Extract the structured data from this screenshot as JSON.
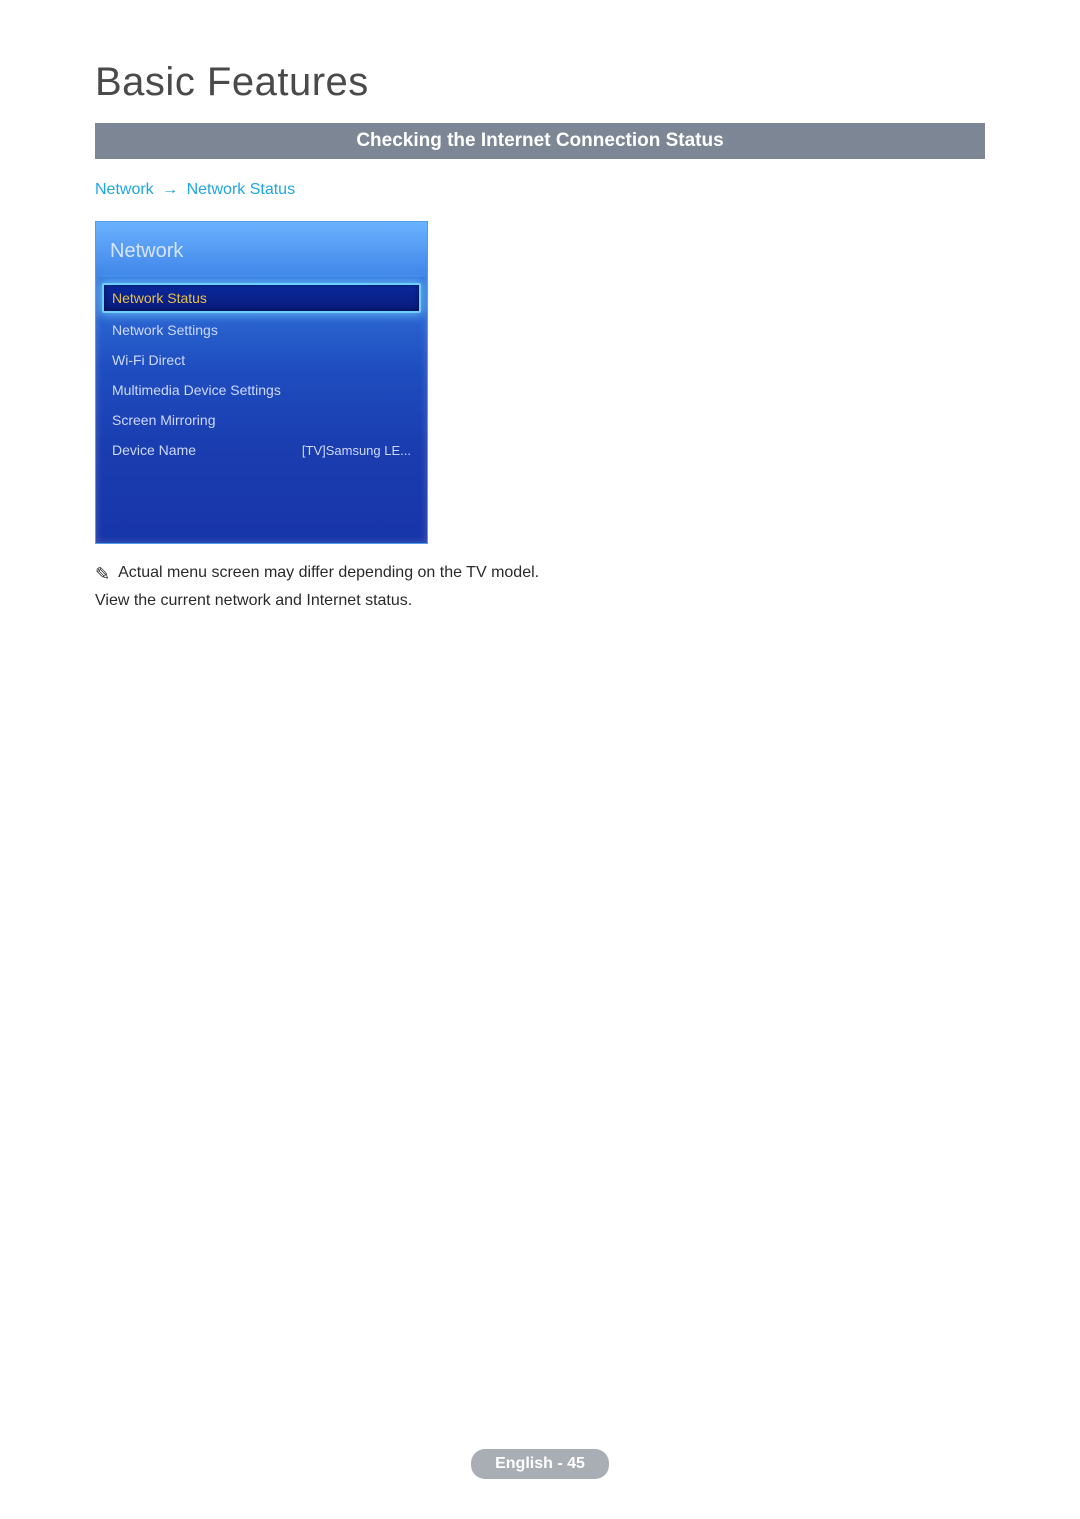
{
  "page_title": "Basic Features",
  "section_bar": "Checking the Internet Connection Status",
  "breadcrumb": {
    "seg1": "Network",
    "arrow": "→",
    "seg2": "Network Status"
  },
  "menu": {
    "header": "Network",
    "items": [
      {
        "label": "Network Status",
        "value": "",
        "selected": true
      },
      {
        "label": "Network Settings",
        "value": "",
        "selected": false
      },
      {
        "label": "Wi-Fi Direct",
        "value": "",
        "selected": false
      },
      {
        "label": "Multimedia Device Settings",
        "value": "",
        "selected": false
      },
      {
        "label": "Screen Mirroring",
        "value": "",
        "selected": false
      },
      {
        "label": "Device Name",
        "value": "[TV]Samsung LE...",
        "selected": false
      }
    ]
  },
  "note_icon_glyph": "✎",
  "note_text": "Actual menu screen may differ depending on the TV model.",
  "body_text": "View the current network and Internet status.",
  "footer": "English - 45"
}
